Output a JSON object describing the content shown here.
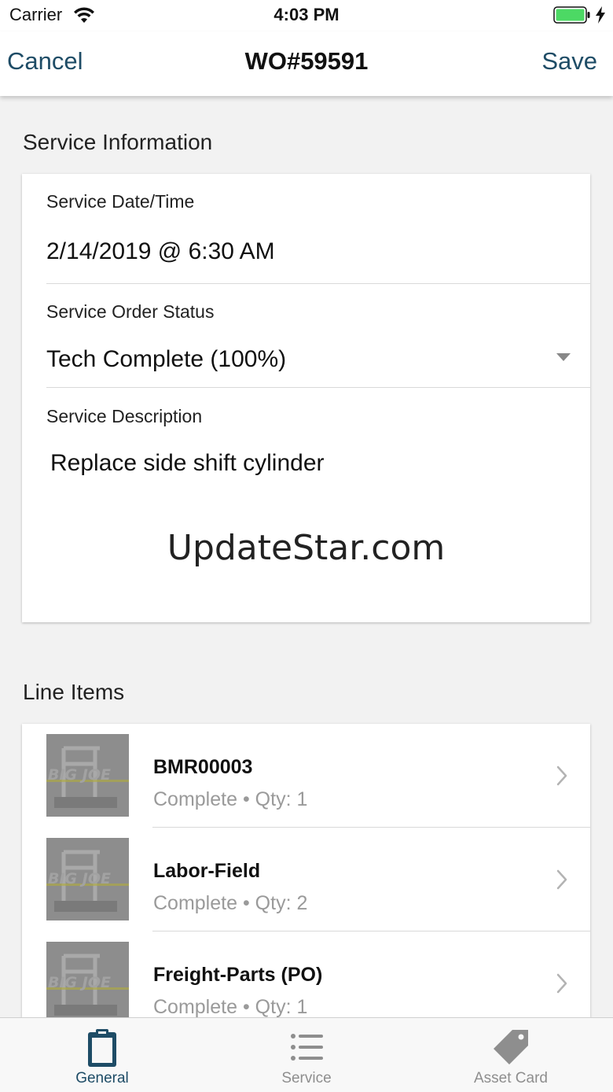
{
  "status_bar": {
    "carrier": "Carrier",
    "time": "4:03 PM",
    "icons": [
      "wifi-icon",
      "battery-icon",
      "charging-bolt-icon"
    ]
  },
  "nav": {
    "cancel_label": "Cancel",
    "title": "WO#59591",
    "save_label": "Save"
  },
  "service_info": {
    "section_title": "Service Information",
    "date_label": "Service Date/Time",
    "date_value": "2/14/2019 @ 6:30 AM",
    "status_label": "Service Order Status",
    "status_value": "Tech Complete (100%)",
    "description_label": "Service Description",
    "description_value": "Replace side shift cylinder"
  },
  "watermark": "UpdateStar.com",
  "line_items": {
    "section_title": "Line Items",
    "items": [
      {
        "name": "BMR00003",
        "status": "Complete",
        "qty": "Qty: 1",
        "separator": "•",
        "thumb_text": "BIG JOE"
      },
      {
        "name": "Labor-Field",
        "status": "Complete",
        "qty": "Qty: 2",
        "separator": "•",
        "thumb_text": "BIG JOE"
      },
      {
        "name": "Freight-Parts (PO)",
        "status": "Complete",
        "qty": "Qty: 1",
        "separator": "•",
        "thumb_text": "BIG JOE"
      }
    ]
  },
  "tabs": [
    {
      "label": "General",
      "icon": "clipboard-icon",
      "active": true
    },
    {
      "label": "Service",
      "icon": "list-icon",
      "active": false
    },
    {
      "label": "Asset Card",
      "icon": "tag-icon",
      "active": false
    }
  ],
  "colors": {
    "accent": "#1e4c66",
    "active_tab": "#1e4c66",
    "inactive_tab": "#8e8e8e",
    "battery": "#4cd964",
    "background": "#f2f2f2"
  }
}
